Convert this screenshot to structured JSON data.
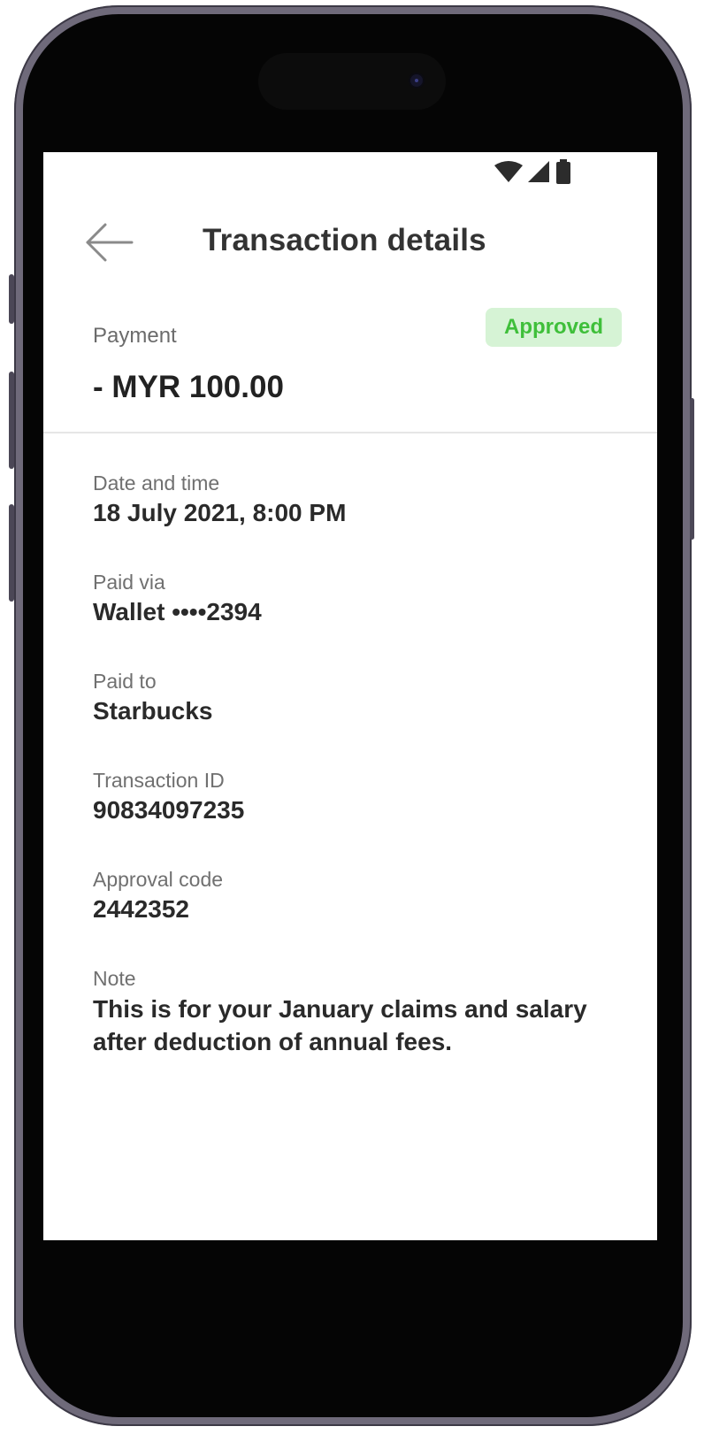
{
  "app": {
    "header": {
      "title": "Transaction details",
      "back_icon": "arrow-left-icon"
    },
    "status_bar": {
      "icons": [
        "wifi-icon",
        "signal-icon",
        "battery-icon"
      ]
    }
  },
  "summary": {
    "type_label": "Payment",
    "status": "Approved",
    "amount": "- MYR 100.00",
    "colors": {
      "badge_bg": "#d6f3d5",
      "badge_text": "#3fbf3a"
    }
  },
  "details": [
    {
      "label": "Date and time",
      "value": "18 July 2021, 8:00 PM"
    },
    {
      "label": "Paid via",
      "value": "Wallet ••••2394"
    },
    {
      "label": "Paid to",
      "value": "Starbucks"
    },
    {
      "label": "Transaction ID",
      "value": "90834097235"
    },
    {
      "label": "Approval code",
      "value": "2442352"
    },
    {
      "label": "Note",
      "value": "This is for your January claims and salary after deduction of annual fees."
    }
  ]
}
